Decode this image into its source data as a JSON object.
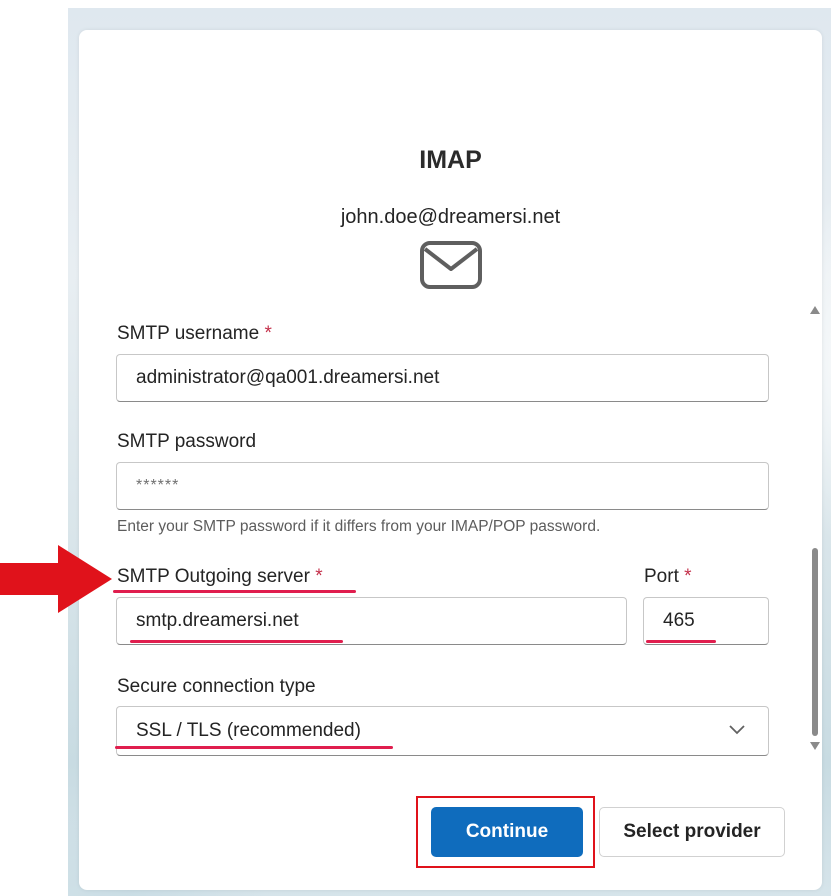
{
  "dialog": {
    "title": "IMAP",
    "email": "john.doe@dreamersi.net",
    "icon": "mail-icon"
  },
  "smtp_username": {
    "label": "SMTP username",
    "required_mark": "*",
    "value": "administrator@qa001.dreamersi.net"
  },
  "smtp_password": {
    "label": "SMTP password",
    "placeholder": "******",
    "helper": "Enter your SMTP password if it differs from your IMAP/POP password."
  },
  "smtp_server": {
    "label": "SMTP Outgoing server",
    "required_mark": "*",
    "value": "smtp.dreamersi.net"
  },
  "port": {
    "label": "Port",
    "required_mark": "*",
    "value": "465"
  },
  "connection_type": {
    "label": "Secure connection type",
    "value": "SSL / TLS (recommended)"
  },
  "buttons": {
    "continue": "Continue",
    "select_provider": "Select provider"
  },
  "colors": {
    "primary": "#0f6cbd",
    "required": "#c4314b",
    "annotation": "#e0121b"
  }
}
